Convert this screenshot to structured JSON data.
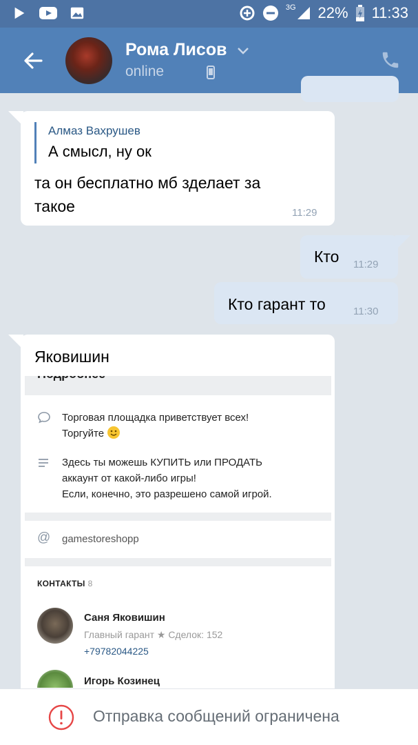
{
  "status_bar": {
    "network": "3G",
    "battery": "22%",
    "time": "11:33"
  },
  "header": {
    "name": "Рома Лисов",
    "presence": "online"
  },
  "messages": [
    {
      "direction": "in",
      "reply_author": "Алмаз Вахрушев",
      "reply_text": "А смысл, ну ок",
      "text_lines": [
        "та он бесплатно мб зделает за",
        "такое"
      ],
      "time": "11:29"
    },
    {
      "direction": "out",
      "text": "Кто",
      "time": "11:29"
    },
    {
      "direction": "out",
      "text": "Кто гарант то",
      "time": "11:30"
    },
    {
      "direction": "in",
      "text": "Яковишин",
      "screenshot": {
        "title": "Подробнее",
        "rows": [
          {
            "icon": "speech-bubble-icon",
            "lines": [
              "Торговая площадка приветствует всех!",
              "Торгуйте"
            ]
          },
          {
            "icon": "text-lines-icon",
            "lines": [
              "Здесь ты можешь КУПИТЬ или ПРОДАТЬ",
              "аккаунт от какой-либо игры!",
              "Если, конечно, это разрешено самой игрой."
            ]
          }
        ],
        "link": "gamestoreshopp",
        "contacts_label": "КОНТАКТЫ",
        "contacts_count": "8",
        "contacts": [
          {
            "name": "Саня Яковишин",
            "role": "Главный гарант ★ Сделок: 152",
            "phone": "+79782044225"
          },
          {
            "name": "Игорь Козинец",
            "role": "",
            "phone": ""
          }
        ]
      }
    }
  ],
  "bottom_bar": {
    "text": "Отправка сообщений ограничена"
  },
  "colors": {
    "header": "#5181b8",
    "status_bar": "#4d73a4",
    "chat_background": "#dee4ea",
    "outgoing_bubble": "#dbe6f3",
    "warning": "#e64646"
  }
}
